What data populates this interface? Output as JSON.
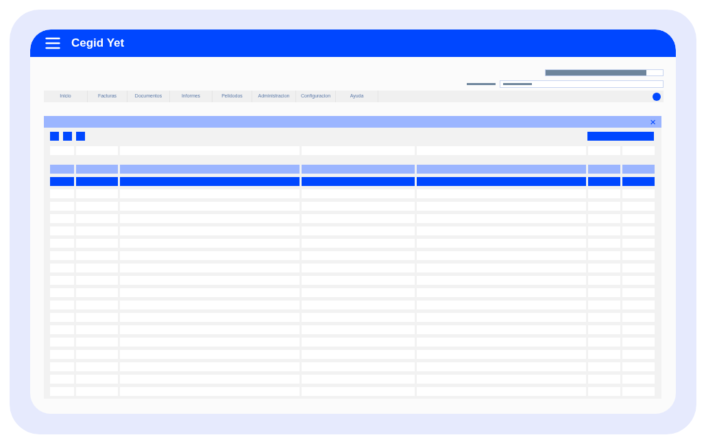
{
  "app_bar": {
    "title": "Cegid Yet"
  },
  "menu": [
    {
      "label": "Inicio"
    },
    {
      "label": "Facturas"
    },
    {
      "label": "Documentos"
    },
    {
      "label": "Informes"
    },
    {
      "label": "Pelidodos"
    },
    {
      "label": "Administracion"
    },
    {
      "label": "Configuracion"
    },
    {
      "label": "Ayuda"
    }
  ],
  "panel": {
    "close_glyph": "×"
  },
  "table": {
    "rows": [
      {
        "selected": true
      },
      {
        "selected": false
      },
      {
        "selected": false
      },
      {
        "selected": false
      },
      {
        "selected": false
      },
      {
        "selected": false
      },
      {
        "selected": false
      },
      {
        "selected": false
      },
      {
        "selected": false
      },
      {
        "selected": false
      },
      {
        "selected": false
      },
      {
        "selected": false
      },
      {
        "selected": false
      },
      {
        "selected": false
      },
      {
        "selected": false
      },
      {
        "selected": false
      },
      {
        "selected": false
      },
      {
        "selected": false
      }
    ]
  }
}
